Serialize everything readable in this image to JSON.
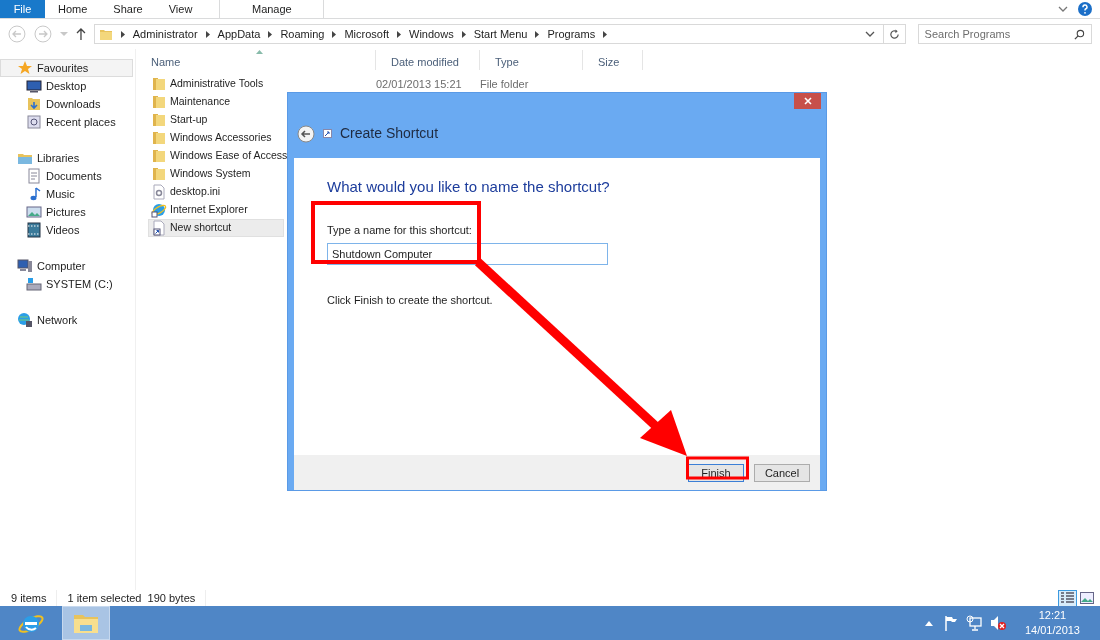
{
  "ribbon": {
    "tabs": [
      {
        "label": "File",
        "kind": "file",
        "selected": false
      },
      {
        "label": "Home",
        "kind": "tab",
        "selected": false
      },
      {
        "label": "Share",
        "kind": "tab",
        "selected": false
      },
      {
        "label": "View",
        "kind": "tab",
        "selected": false
      },
      {
        "label": "Manage",
        "kind": "context",
        "selected": false
      }
    ]
  },
  "address_bar": {
    "path": [
      "Administrator",
      "AppData",
      "Roaming",
      "Microsoft",
      "Windows",
      "Start Menu",
      "Programs"
    ]
  },
  "search": {
    "placeholder": "Search Programs"
  },
  "sidebar": {
    "groups": [
      {
        "label": "Favourites",
        "kind": "star",
        "selected": true,
        "children": [
          {
            "label": "Desktop",
            "kind": "desktop",
            "selected": false
          },
          {
            "label": "Downloads",
            "kind": "downloads",
            "selected": false
          },
          {
            "label": "Recent places",
            "kind": "recent",
            "selected": false
          }
        ]
      },
      {
        "label": "Libraries",
        "kind": "libraries",
        "selected": false,
        "children": [
          {
            "label": "Documents",
            "kind": "documents",
            "selected": false
          },
          {
            "label": "Music",
            "kind": "music",
            "selected": false
          },
          {
            "label": "Pictures",
            "kind": "pictures",
            "selected": false
          },
          {
            "label": "Videos",
            "kind": "videos",
            "selected": false
          }
        ]
      },
      {
        "label": "Computer",
        "kind": "computer",
        "selected": false,
        "children": [
          {
            "label": "SYSTEM (C:)",
            "kind": "drive",
            "selected": false
          }
        ]
      },
      {
        "label": "Network",
        "kind": "network",
        "selected": false
      }
    ]
  },
  "file_list": {
    "columns": [
      "Name",
      "Date modified",
      "Type",
      "Size"
    ],
    "rows": [
      {
        "name": "Administrative Tools",
        "kind": "folder",
        "date": "02/01/2013 15:21",
        "type": "File folder",
        "selected": false
      },
      {
        "name": "Maintenance",
        "kind": "folder",
        "selected": false
      },
      {
        "name": "Start-up",
        "kind": "folder",
        "selected": false
      },
      {
        "name": "Windows Accessories",
        "kind": "folder",
        "selected": false
      },
      {
        "name": "Windows Ease of Access",
        "kind": "folder",
        "selected": false
      },
      {
        "name": "Windows System",
        "kind": "folder",
        "selected": false
      },
      {
        "name": "desktop.ini",
        "kind": "settings",
        "selected": false
      },
      {
        "name": "Internet Explorer",
        "kind": "browser",
        "selected": false
      },
      {
        "name": "New shortcut",
        "kind": "shortcut",
        "selected": true
      }
    ]
  },
  "dialog": {
    "title": "Create Shortcut",
    "heading": "What would you like to name the shortcut?",
    "field_label": "Type a name for this shortcut:",
    "field_value": "Shutdown Computer",
    "hint": "Click Finish to create the shortcut.",
    "buttons": [
      "Finish",
      "Cancel"
    ]
  },
  "status_bar": {
    "items": [
      "9 items",
      "1 item selected  190 bytes"
    ]
  },
  "taskbar": {
    "time": "12:21",
    "date": "14/01/2013"
  }
}
